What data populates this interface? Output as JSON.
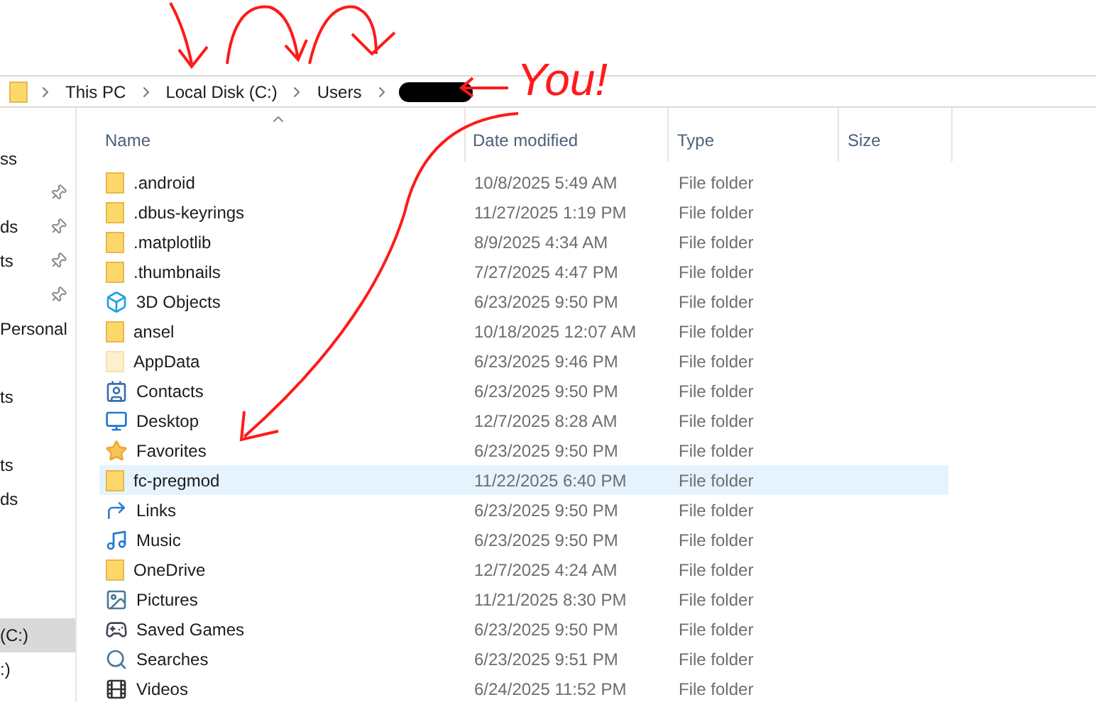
{
  "breadcrumb": [
    "This PC",
    "Local Disk (C:)",
    "Users"
  ],
  "annotation": {
    "text": "You!"
  },
  "nav": [
    {
      "kind": "item",
      "label": "ss",
      "pinned": false,
      "selected": false
    },
    {
      "kind": "item",
      "pinned": true,
      "selected": false
    },
    {
      "kind": "item",
      "label": "ds",
      "pinned": true,
      "selected": false
    },
    {
      "kind": "item",
      "label": "ts",
      "pinned": true,
      "selected": false
    },
    {
      "kind": "item",
      "pinned": true,
      "selected": false
    },
    {
      "kind": "item",
      "label": "Personal",
      "pinned": false,
      "selected": false
    },
    {
      "kind": "spacer"
    },
    {
      "kind": "item",
      "label": "ts",
      "pinned": false,
      "selected": false
    },
    {
      "kind": "spacer"
    },
    {
      "kind": "item",
      "label": "ts",
      "pinned": false,
      "selected": false
    },
    {
      "kind": "item",
      "label": "ds",
      "pinned": false,
      "selected": false
    },
    {
      "kind": "spacer"
    },
    {
      "kind": "spacer"
    },
    {
      "kind": "spacer"
    },
    {
      "kind": "item",
      "label": "(C:)",
      "pinned": false,
      "selected": true
    },
    {
      "kind": "item",
      "label": ":)",
      "pinned": false,
      "selected": false
    }
  ],
  "columns": [
    "Name",
    "Date modified",
    "Type",
    "Size"
  ],
  "rows": [
    {
      "kind": "folder",
      "name": ".android",
      "date": "10/8/2025 5:49 AM",
      "type": "File folder",
      "selected": false
    },
    {
      "kind": "folder",
      "name": ".dbus-keyrings",
      "date": "11/27/2025 1:19 PM",
      "type": "File folder",
      "selected": false
    },
    {
      "kind": "folder",
      "name": ".matplotlib",
      "date": "8/9/2025 4:34 AM",
      "type": "File folder",
      "selected": false
    },
    {
      "kind": "folder",
      "name": ".thumbnails",
      "date": "7/27/2025 4:47 PM",
      "type": "File folder",
      "selected": false
    },
    {
      "kind": "cube",
      "name": "3D Objects",
      "date": "6/23/2025 9:50 PM",
      "type": "File folder",
      "selected": false
    },
    {
      "kind": "folder",
      "name": "ansel",
      "date": "10/18/2025 12:07 AM",
      "type": "File folder",
      "selected": false
    },
    {
      "kind": "hidden",
      "name": "AppData",
      "date": "6/23/2025 9:46 PM",
      "type": "File folder",
      "selected": false
    },
    {
      "kind": "contacts",
      "name": "Contacts",
      "date": "6/23/2025 9:50 PM",
      "type": "File folder",
      "selected": false
    },
    {
      "kind": "desktop",
      "name": "Desktop",
      "date": "12/7/2025 8:28 AM",
      "type": "File folder",
      "selected": false
    },
    {
      "kind": "star",
      "name": "Favorites",
      "date": "6/23/2025 9:50 PM",
      "type": "File folder",
      "selected": false
    },
    {
      "kind": "folder",
      "name": "fc-pregmod",
      "date": "11/22/2025 6:40 PM",
      "type": "File folder",
      "selected": true
    },
    {
      "kind": "link",
      "name": "Links",
      "date": "6/23/2025 9:50 PM",
      "type": "File folder",
      "selected": false
    },
    {
      "kind": "music",
      "name": "Music",
      "date": "6/23/2025 9:50 PM",
      "type": "File folder",
      "selected": false
    },
    {
      "kind": "folder",
      "name": "OneDrive",
      "date": "12/7/2025 4:24 AM",
      "type": "File folder",
      "selected": false
    },
    {
      "kind": "pictures",
      "name": "Pictures",
      "date": "11/21/2025 8:30 PM",
      "type": "File folder",
      "selected": false
    },
    {
      "kind": "games",
      "name": "Saved Games",
      "date": "6/23/2025 9:50 PM",
      "type": "File folder",
      "selected": false
    },
    {
      "kind": "search",
      "name": "Searches",
      "date": "6/23/2025 9:51 PM",
      "type": "File folder",
      "selected": false
    },
    {
      "kind": "video",
      "name": "Videos",
      "date": "6/24/2025 11:52 PM",
      "type": "File folder",
      "selected": false
    }
  ]
}
